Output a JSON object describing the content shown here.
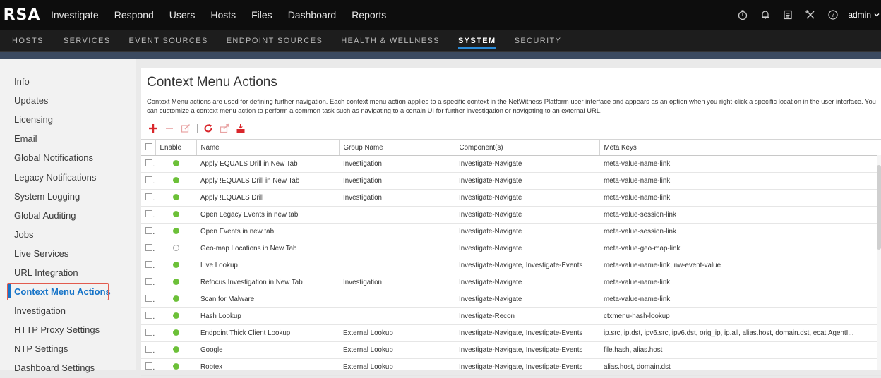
{
  "brand": {
    "logo_text": "RSA"
  },
  "main_nav": [
    {
      "label": "Investigate"
    },
    {
      "label": "Respond"
    },
    {
      "label": "Users"
    },
    {
      "label": "Hosts"
    },
    {
      "label": "Files"
    },
    {
      "label": "Dashboard"
    },
    {
      "label": "Reports"
    }
  ],
  "top_icons": [
    "stopwatch-icon",
    "bell-icon",
    "clipboard-icon",
    "tools-icon",
    "help-icon"
  ],
  "user": {
    "name": "admin"
  },
  "sub_nav": [
    {
      "label": "HOSTS"
    },
    {
      "label": "SERVICES"
    },
    {
      "label": "EVENT SOURCES"
    },
    {
      "label": "ENDPOINT SOURCES"
    },
    {
      "label": "HEALTH & WELLNESS"
    },
    {
      "label": "SYSTEM",
      "active": true
    },
    {
      "label": "SECURITY"
    }
  ],
  "sidebar": {
    "items": [
      {
        "label": "Info"
      },
      {
        "label": "Updates"
      },
      {
        "label": "Licensing"
      },
      {
        "label": "Email"
      },
      {
        "label": "Global Notifications"
      },
      {
        "label": "Legacy Notifications"
      },
      {
        "label": "System Logging"
      },
      {
        "label": "Global Auditing"
      },
      {
        "label": "Jobs"
      },
      {
        "label": "Live Services"
      },
      {
        "label": "URL Integration"
      },
      {
        "label": "Context Menu Actions",
        "active": true
      },
      {
        "label": "Investigation"
      },
      {
        "label": "HTTP Proxy Settings"
      },
      {
        "label": "NTP Settings"
      },
      {
        "label": "Dashboard Settings"
      }
    ]
  },
  "main": {
    "title": "Context Menu Actions",
    "description": "Context Menu actions are used for defining further navigation. Each context menu action applies to a specific context in the NetWitness Platform user interface and appears as an option when you right-click a specific location in the user interface. You can customize a context menu action to perform a common task such as navigating to a certain UI for further investigation or navigating to an external URL.",
    "toolbar": [
      "add-icon",
      "remove-icon",
      "edit-icon",
      "refresh-icon",
      "export-icon",
      "import-icon"
    ],
    "columns": {
      "enable": "Enable",
      "name": "Name",
      "group": "Group Name",
      "components": "Component(s)",
      "meta": "Meta Keys"
    },
    "rows": [
      {
        "enabled": true,
        "name": "Apply EQUALS Drill in New Tab",
        "group": "Investigation",
        "components": "Investigate-Navigate",
        "meta": "meta-value-name-link"
      },
      {
        "enabled": true,
        "name": "Apply !EQUALS Drill in New Tab",
        "group": "Investigation",
        "components": "Investigate-Navigate",
        "meta": "meta-value-name-link"
      },
      {
        "enabled": true,
        "name": "Apply !EQUALS Drill",
        "group": "Investigation",
        "components": "Investigate-Navigate",
        "meta": "meta-value-name-link"
      },
      {
        "enabled": true,
        "name": "Open Legacy Events in new tab",
        "group": "",
        "components": "Investigate-Navigate",
        "meta": "meta-value-session-link"
      },
      {
        "enabled": true,
        "name": "Open Events in new tab",
        "group": "",
        "components": "Investigate-Navigate",
        "meta": "meta-value-session-link"
      },
      {
        "enabled": false,
        "name": "Geo-map Locations in New Tab",
        "group": "",
        "components": "Investigate-Navigate",
        "meta": "meta-value-geo-map-link"
      },
      {
        "enabled": true,
        "name": "Live Lookup",
        "group": "",
        "components": "Investigate-Navigate, Investigate-Events",
        "meta": "meta-value-name-link, nw-event-value"
      },
      {
        "enabled": true,
        "name": "Refocus Investigation in New Tab",
        "group": "Investigation",
        "components": "Investigate-Navigate",
        "meta": "meta-value-name-link"
      },
      {
        "enabled": true,
        "name": "Scan for Malware",
        "group": "",
        "components": "Investigate-Navigate",
        "meta": "meta-value-name-link"
      },
      {
        "enabled": true,
        "name": "Hash Lookup",
        "group": "",
        "components": "Investigate-Recon",
        "meta": "ctxmenu-hash-lookup"
      },
      {
        "enabled": true,
        "name": "Endpoint Thick Client Lookup",
        "group": "External Lookup",
        "components": "Investigate-Navigate, Investigate-Events",
        "meta": "ip.src, ip.dst, ipv6.src, ipv6.dst, orig_ip, ip.all, alias.host, domain.dst, ecat.AgentI..."
      },
      {
        "enabled": true,
        "name": "Google",
        "group": "External Lookup",
        "components": "Investigate-Navigate, Investigate-Events",
        "meta": "file.hash, alias.host"
      },
      {
        "enabled": true,
        "name": "Robtex",
        "group": "External Lookup",
        "components": "Investigate-Navigate, Investigate-Events",
        "meta": "alias.host, domain.dst"
      }
    ]
  },
  "colors": {
    "topbar": "#0d0d0d",
    "subnav": "#1d1d1d",
    "accent": "#2a8bd8",
    "enabled_dot": "#6cc038",
    "highlight_box": "#e25b4e",
    "add_icon": "#d9262b"
  }
}
